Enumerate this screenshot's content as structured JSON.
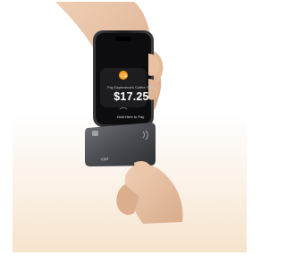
{
  "phone_screen": {
    "caption": "Pay Esperanza's Coffee Shop",
    "amount": "$17.25",
    "instruction": "Hold Here to Pay"
  },
  "card": {
    "number_fragment": "7083"
  },
  "colors": {
    "accent_orange": "#f39a1a",
    "phone_black": "#151516",
    "card_gray": "#4b4d52",
    "background_peach": "#f6e3cc"
  },
  "icons": [
    "merchant-logo-icon",
    "contactless-icon",
    "card-chip-icon"
  ]
}
